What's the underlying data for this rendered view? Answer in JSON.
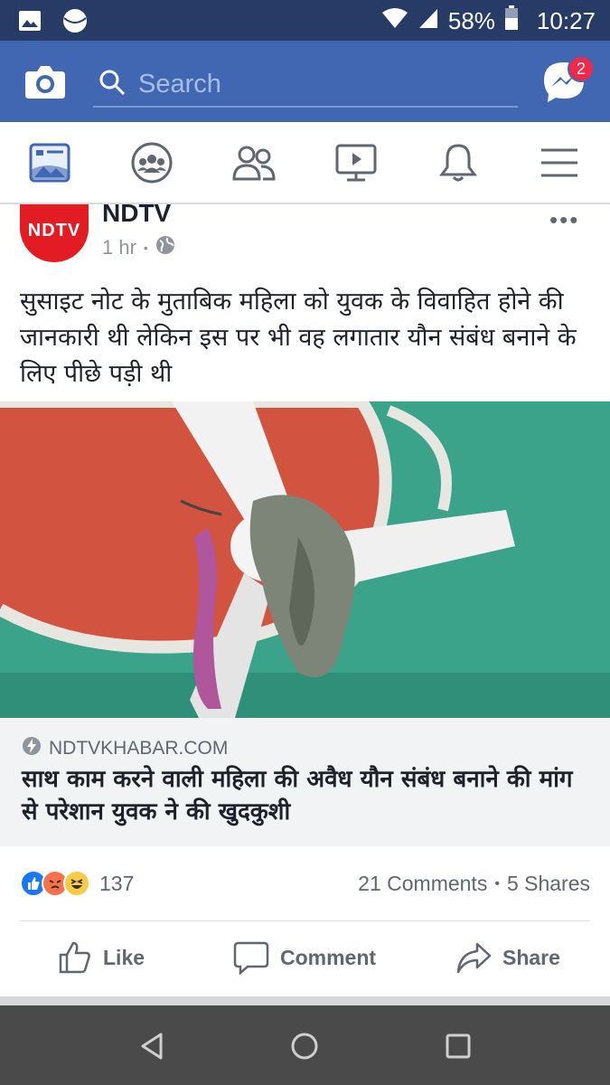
{
  "status": {
    "battery": "58%",
    "time": "10:27"
  },
  "header": {
    "search_placeholder": "Search",
    "messenger_badge": "2"
  },
  "tabs": [
    "news-feed",
    "groups",
    "friends",
    "watch",
    "notifications",
    "menu"
  ],
  "post": {
    "author": "NDTV",
    "avatar_text": "NDTV",
    "time": "1 hr",
    "more": "•••",
    "text": "सुसाइट नोट के मुताबिक महिला को युवक के विवाहित होने की जानकारी थी लेकिन इस पर भी वह लगातार यौन संबंध बनाने के लिए पीछे पड़ी थी",
    "link": {
      "domain": "NDTVKHABAR.COM",
      "title": "साथ काम करने वाली महिला की अवैध यौन संबंध बनाने की मांग से परेशान युवक ने की खुदकुशी"
    },
    "reaction_count": "137",
    "comments": "21 Comments",
    "separator": "•",
    "shares": "5 Shares",
    "actions": {
      "like": "Like",
      "comment": "Comment",
      "share": "Share"
    }
  },
  "colors": {
    "brand": "#4267b2",
    "statusbar": "#283b66"
  }
}
